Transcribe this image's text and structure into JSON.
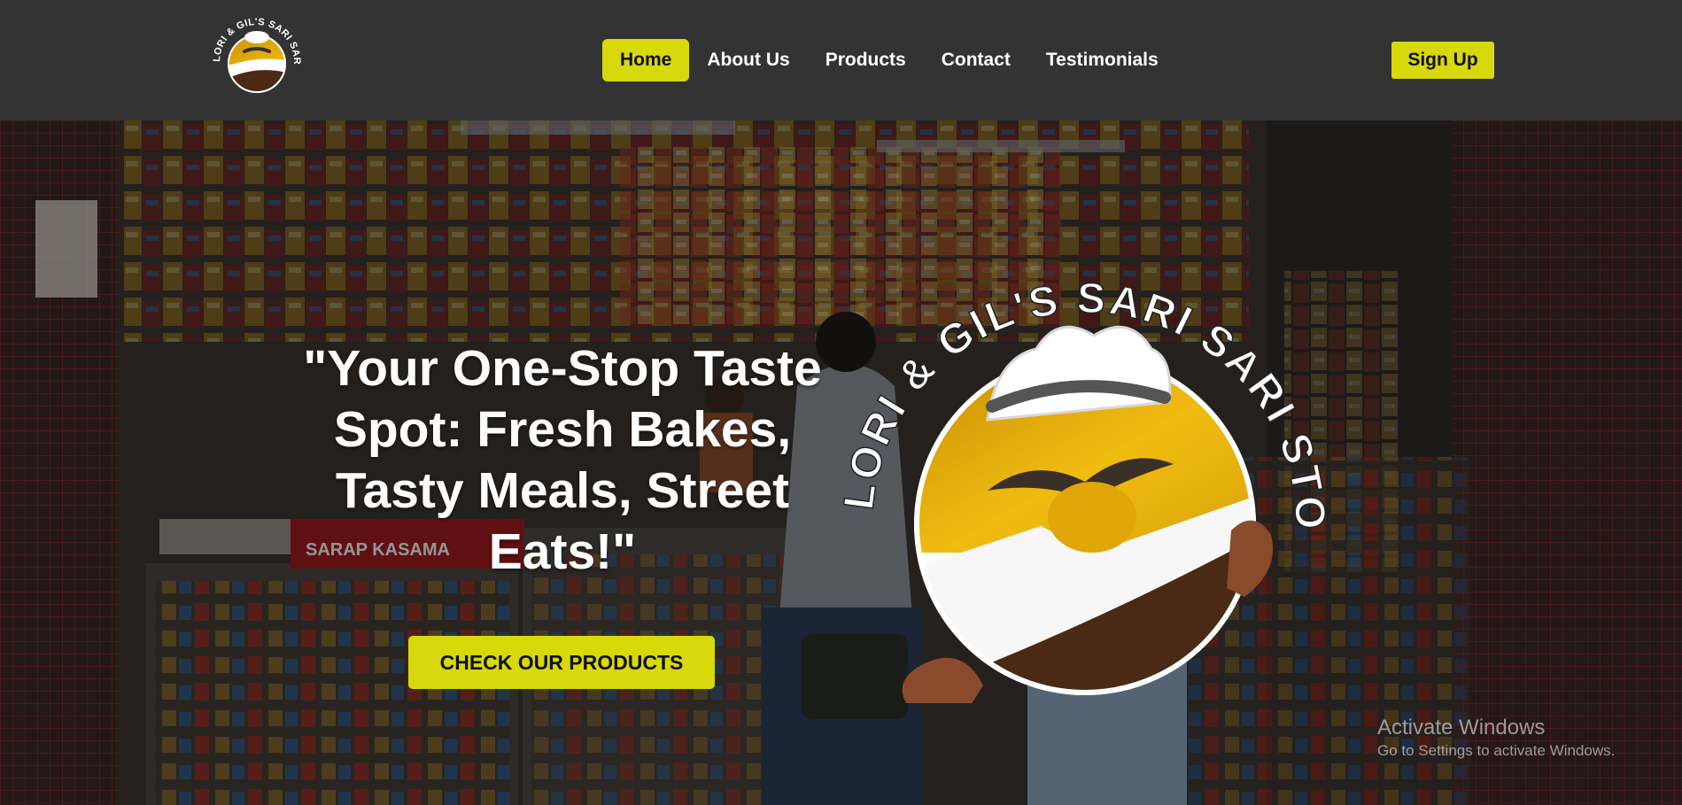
{
  "brand": {
    "name_arc": "LORI & GIL'S SARI SARI STORE"
  },
  "nav": {
    "items": [
      {
        "label": "Home",
        "active": true
      },
      {
        "label": "About Us",
        "active": false
      },
      {
        "label": "Products",
        "active": false
      },
      {
        "label": "Contact",
        "active": false
      },
      {
        "label": "Testimonials",
        "active": false
      }
    ],
    "signup_label": "Sign Up"
  },
  "hero": {
    "headline": "\"Your One-Stop Taste Spot: Fresh Bakes, Tasty Meals, Street Eats!\"",
    "cta_label": "CHECK OUR PRODUCTS",
    "store_sign": "SARAP KASAMA"
  },
  "watermark": {
    "title": "Activate Windows",
    "subtitle": "Go to Settings to activate Windows."
  },
  "colors": {
    "nav_bg": "#333333",
    "accent": "#d7d90a",
    "logo_gold": "#e8b40c",
    "logo_brown": "#4a2a14"
  }
}
